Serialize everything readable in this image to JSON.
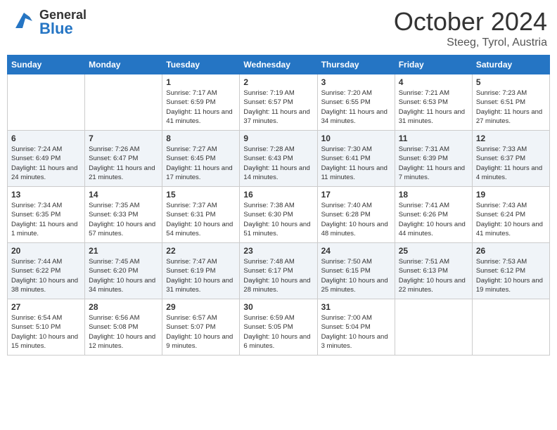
{
  "header": {
    "logo_general": "General",
    "logo_blue": "Blue",
    "month_year": "October 2024",
    "location": "Steeg, Tyrol, Austria"
  },
  "calendar": {
    "days_of_week": [
      "Sunday",
      "Monday",
      "Tuesday",
      "Wednesday",
      "Thursday",
      "Friday",
      "Saturday"
    ],
    "weeks": [
      [
        {
          "day": "",
          "content": ""
        },
        {
          "day": "",
          "content": ""
        },
        {
          "day": "1",
          "content": "Sunrise: 7:17 AM\nSunset: 6:59 PM\nDaylight: 11 hours and 41 minutes."
        },
        {
          "day": "2",
          "content": "Sunrise: 7:19 AM\nSunset: 6:57 PM\nDaylight: 11 hours and 37 minutes."
        },
        {
          "day": "3",
          "content": "Sunrise: 7:20 AM\nSunset: 6:55 PM\nDaylight: 11 hours and 34 minutes."
        },
        {
          "day": "4",
          "content": "Sunrise: 7:21 AM\nSunset: 6:53 PM\nDaylight: 11 hours and 31 minutes."
        },
        {
          "day": "5",
          "content": "Sunrise: 7:23 AM\nSunset: 6:51 PM\nDaylight: 11 hours and 27 minutes."
        }
      ],
      [
        {
          "day": "6",
          "content": "Sunrise: 7:24 AM\nSunset: 6:49 PM\nDaylight: 11 hours and 24 minutes."
        },
        {
          "day": "7",
          "content": "Sunrise: 7:26 AM\nSunset: 6:47 PM\nDaylight: 11 hours and 21 minutes."
        },
        {
          "day": "8",
          "content": "Sunrise: 7:27 AM\nSunset: 6:45 PM\nDaylight: 11 hours and 17 minutes."
        },
        {
          "day": "9",
          "content": "Sunrise: 7:28 AM\nSunset: 6:43 PM\nDaylight: 11 hours and 14 minutes."
        },
        {
          "day": "10",
          "content": "Sunrise: 7:30 AM\nSunset: 6:41 PM\nDaylight: 11 hours and 11 minutes."
        },
        {
          "day": "11",
          "content": "Sunrise: 7:31 AM\nSunset: 6:39 PM\nDaylight: 11 hours and 7 minutes."
        },
        {
          "day": "12",
          "content": "Sunrise: 7:33 AM\nSunset: 6:37 PM\nDaylight: 11 hours and 4 minutes."
        }
      ],
      [
        {
          "day": "13",
          "content": "Sunrise: 7:34 AM\nSunset: 6:35 PM\nDaylight: 11 hours and 1 minute."
        },
        {
          "day": "14",
          "content": "Sunrise: 7:35 AM\nSunset: 6:33 PM\nDaylight: 10 hours and 57 minutes."
        },
        {
          "day": "15",
          "content": "Sunrise: 7:37 AM\nSunset: 6:31 PM\nDaylight: 10 hours and 54 minutes."
        },
        {
          "day": "16",
          "content": "Sunrise: 7:38 AM\nSunset: 6:30 PM\nDaylight: 10 hours and 51 minutes."
        },
        {
          "day": "17",
          "content": "Sunrise: 7:40 AM\nSunset: 6:28 PM\nDaylight: 10 hours and 48 minutes."
        },
        {
          "day": "18",
          "content": "Sunrise: 7:41 AM\nSunset: 6:26 PM\nDaylight: 10 hours and 44 minutes."
        },
        {
          "day": "19",
          "content": "Sunrise: 7:43 AM\nSunset: 6:24 PM\nDaylight: 10 hours and 41 minutes."
        }
      ],
      [
        {
          "day": "20",
          "content": "Sunrise: 7:44 AM\nSunset: 6:22 PM\nDaylight: 10 hours and 38 minutes."
        },
        {
          "day": "21",
          "content": "Sunrise: 7:45 AM\nSunset: 6:20 PM\nDaylight: 10 hours and 34 minutes."
        },
        {
          "day": "22",
          "content": "Sunrise: 7:47 AM\nSunset: 6:19 PM\nDaylight: 10 hours and 31 minutes."
        },
        {
          "day": "23",
          "content": "Sunrise: 7:48 AM\nSunset: 6:17 PM\nDaylight: 10 hours and 28 minutes."
        },
        {
          "day": "24",
          "content": "Sunrise: 7:50 AM\nSunset: 6:15 PM\nDaylight: 10 hours and 25 minutes."
        },
        {
          "day": "25",
          "content": "Sunrise: 7:51 AM\nSunset: 6:13 PM\nDaylight: 10 hours and 22 minutes."
        },
        {
          "day": "26",
          "content": "Sunrise: 7:53 AM\nSunset: 6:12 PM\nDaylight: 10 hours and 19 minutes."
        }
      ],
      [
        {
          "day": "27",
          "content": "Sunrise: 6:54 AM\nSunset: 5:10 PM\nDaylight: 10 hours and 15 minutes."
        },
        {
          "day": "28",
          "content": "Sunrise: 6:56 AM\nSunset: 5:08 PM\nDaylight: 10 hours and 12 minutes."
        },
        {
          "day": "29",
          "content": "Sunrise: 6:57 AM\nSunset: 5:07 PM\nDaylight: 10 hours and 9 minutes."
        },
        {
          "day": "30",
          "content": "Sunrise: 6:59 AM\nSunset: 5:05 PM\nDaylight: 10 hours and 6 minutes."
        },
        {
          "day": "31",
          "content": "Sunrise: 7:00 AM\nSunset: 5:04 PM\nDaylight: 10 hours and 3 minutes."
        },
        {
          "day": "",
          "content": ""
        },
        {
          "day": "",
          "content": ""
        }
      ]
    ]
  }
}
